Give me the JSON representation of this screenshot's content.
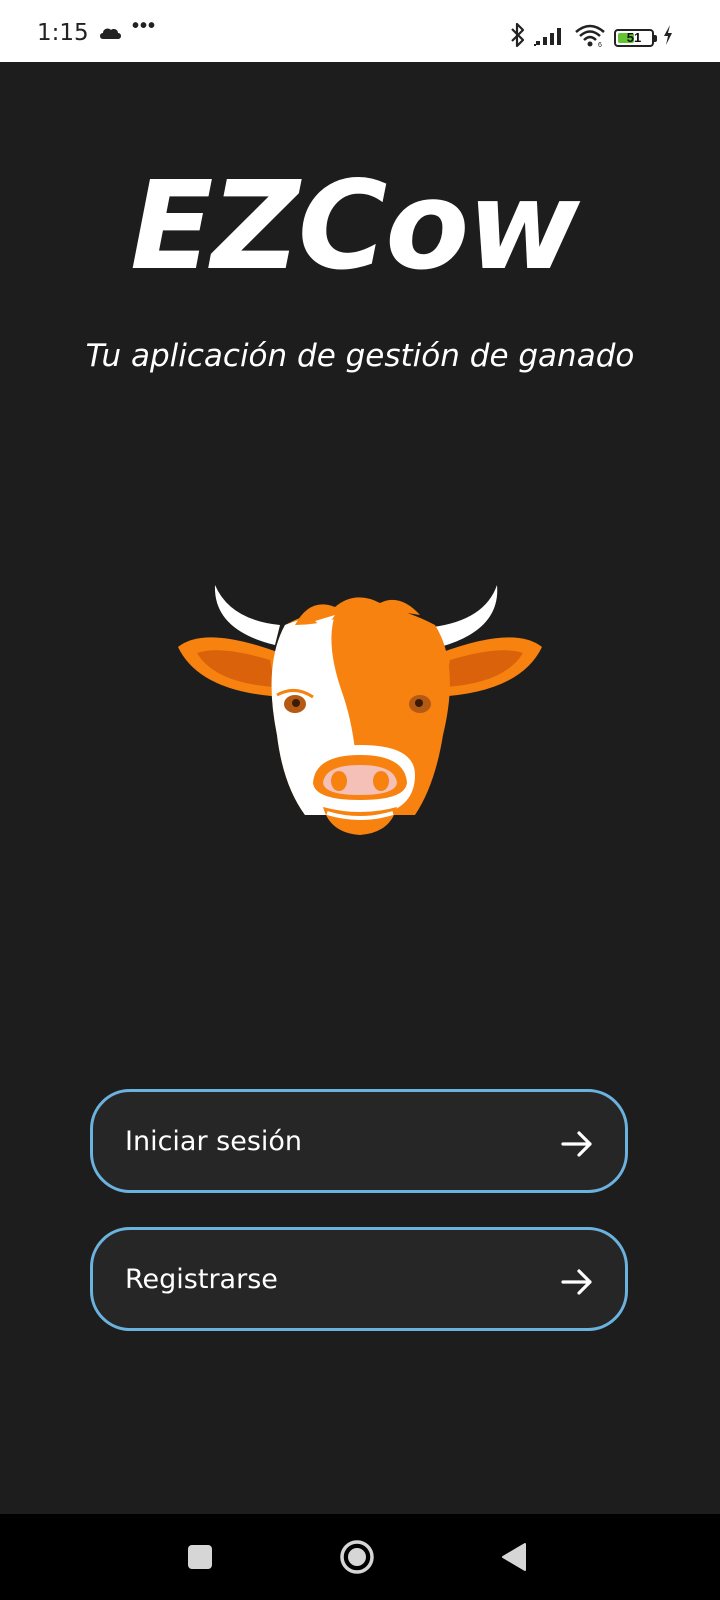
{
  "status_bar": {
    "time": "1:15",
    "more": "•••",
    "battery_level": "51",
    "battery_fraction": 0.51,
    "icons": [
      "cloud-icon",
      "bluetooth-icon",
      "signal-icon",
      "wifi-icon",
      "battery-icon",
      "charging-icon"
    ]
  },
  "header": {
    "title": "EZCow",
    "subtitle": "Tu aplicación de gestión de ganado"
  },
  "illustration": {
    "icon": "cow-head-icon"
  },
  "actions": {
    "login_label": "Iniciar sesión",
    "register_label": "Registrarse",
    "arrow_icon": "arrow-right-icon"
  },
  "nav_bar": {
    "icons": [
      "recents-square-icon",
      "home-circle-icon",
      "back-triangle-icon"
    ]
  },
  "colors": {
    "background": "#1d1d1e",
    "button_border": "#6cb2de",
    "button_fill": "#262627",
    "cow_orange": "#f7820f",
    "text": "#ffffff"
  }
}
